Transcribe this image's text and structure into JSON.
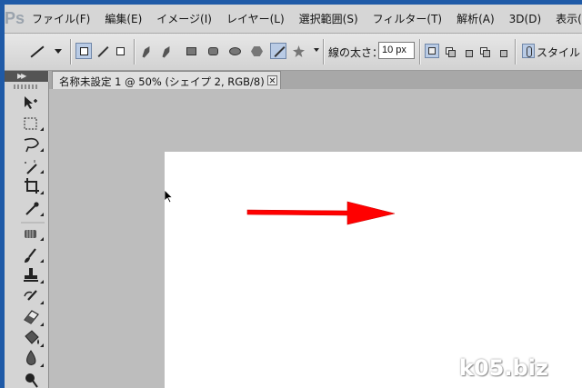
{
  "app": {
    "logo": "Ps"
  },
  "menu": [
    "ファイル(F)",
    "編集(E)",
    "イメージ(I)",
    "レイヤー(L)",
    "選択範囲(S)",
    "フィルター(T)",
    "解析(A)",
    "3D(D)",
    "表示(V)"
  ],
  "options": {
    "stroke_width_label": "線の太さ：",
    "stroke_width_value": "10 px",
    "style_label": "スタイル："
  },
  "document": {
    "tab_title": "名称未設定 1 @ 50% (シェイプ 2, RGB/8) *"
  },
  "drawing": {
    "arrow_color": "#ff0000",
    "canvas_color": "#ffffff"
  },
  "watermark": "k05.biz",
  "colors": {
    "frame": "#1f5aa7",
    "workspace": "#bdbdbd",
    "active_button": "#b9cbe5"
  }
}
